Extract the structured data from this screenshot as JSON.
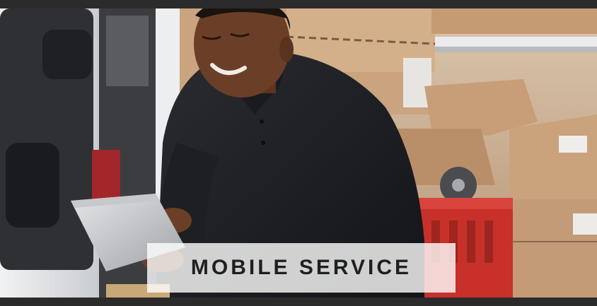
{
  "banner": {
    "caption": "MOBILE SERVICE"
  },
  "photo": {
    "subject": "delivery-person-with-tablet",
    "colors": {
      "frame_background": "#2b2b2b",
      "shirt": "#1c1d21",
      "skin": "#6b3f27",
      "cardboard": "#b88c64",
      "crate": "#c8302a",
      "van_door": "#e8eaec",
      "caption_overlay": "#ffffff"
    }
  }
}
